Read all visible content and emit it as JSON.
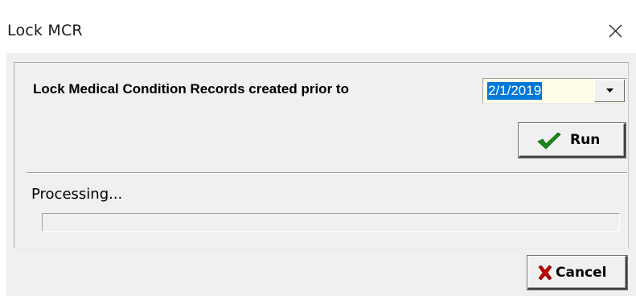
{
  "window": {
    "title": "Lock MCR",
    "close_icon": "close-icon"
  },
  "lock_section": {
    "label": "Lock Medical Condition Records created prior to",
    "date_value": "2/1/2019",
    "dropdown_icon": "chevron-down-icon"
  },
  "run_button": {
    "label": "Run",
    "icon": "checkmark-icon"
  },
  "status": {
    "text": "Processing...",
    "progress_percent": 0
  },
  "cancel_button": {
    "label": "Cancel",
    "icon": "x-icon"
  },
  "colors": {
    "selection": "#0078d7",
    "input_background": "#fffce8",
    "check_green": "#1e8a1e",
    "cancel_red": "#c00000",
    "dialog_background": "#f0f0f0"
  }
}
